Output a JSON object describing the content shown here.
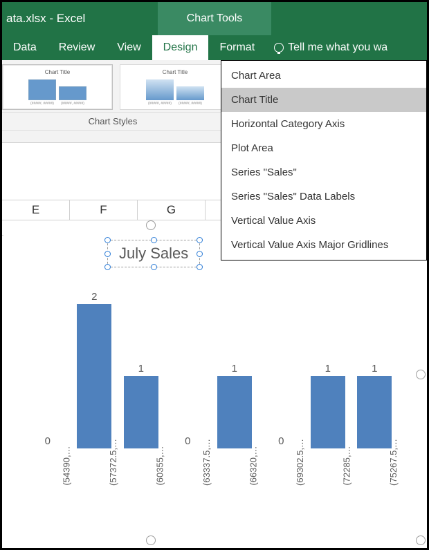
{
  "titlebar": {
    "filename": "ata.xlsx - Excel",
    "tools_label": "Chart Tools"
  },
  "tabs": {
    "data": "Data",
    "review": "Review",
    "view": "View",
    "design": "Design",
    "format": "Format",
    "tellme": "Tell me what you wa"
  },
  "ribbon": {
    "group_label": "Chart Styles",
    "thumb_title": "Chart Title",
    "thumb_cat1": "(#####, #####)",
    "thumb_cat2": "(#####, #####)"
  },
  "dropdown": {
    "items": [
      "Chart Area",
      "Chart Title",
      "Horizontal Category Axis",
      "Plot Area",
      "Series \"Sales\"",
      "Series \"Sales\" Data Labels",
      "Vertical Value Axis",
      "Vertical Value Axis Major Gridlines"
    ],
    "highlight_index": 1
  },
  "columns": {
    "e": "E",
    "f": "F",
    "g": "G"
  },
  "chart": {
    "title": "July Sales"
  },
  "chart_data": {
    "type": "bar",
    "title": "July Sales",
    "xlabel": "",
    "ylabel": "",
    "ylim": [
      0,
      2.2
    ],
    "categories": [
      "(54390,…",
      "(57372.5,…",
      "(60355,…",
      "(63337.5,…",
      "(66320,…",
      "(69302.5,…",
      "(72285,…",
      "(75267.5,…"
    ],
    "values": [
      0,
      2,
      1,
      0,
      1,
      0,
      1,
      1
    ],
    "data_labels": [
      "0",
      "2",
      "1",
      "0",
      "1",
      "0",
      "1",
      "1"
    ]
  },
  "colors": {
    "brand": "#217346",
    "bar": "#4f81bd"
  }
}
